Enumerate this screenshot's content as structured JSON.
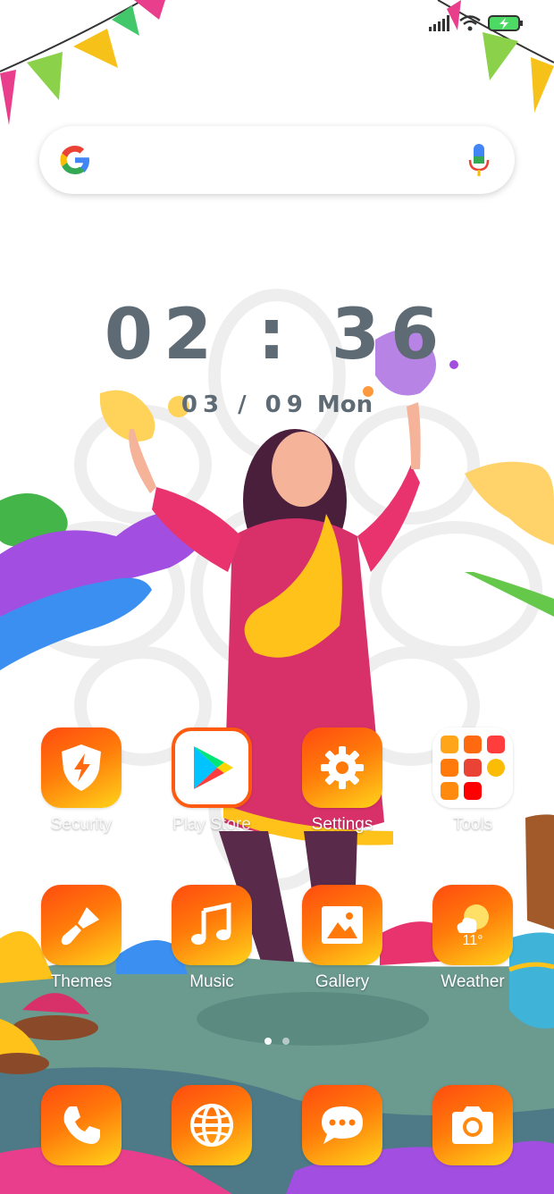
{
  "status_bar": {
    "icons": [
      "signal-icon",
      "wifi-icon",
      "battery-charging-icon"
    ]
  },
  "search": {
    "icons": [
      "google-icon",
      "mic-icon"
    ]
  },
  "clock": {
    "time": "02 : 36",
    "date": "03 / 09",
    "weekday": "Mon"
  },
  "apps": [
    {
      "label": "Security",
      "icon": "shield-bolt-icon"
    },
    {
      "label": "Play Store",
      "icon": "play-store-icon"
    },
    {
      "label": "Settings",
      "icon": "gear-icon"
    },
    {
      "label": "Tools",
      "icon": "folder-icon"
    },
    {
      "label": "Themes",
      "icon": "paintbrush-icon"
    },
    {
      "label": "Music",
      "icon": "music-note-icon"
    },
    {
      "label": "Gallery",
      "icon": "image-icon"
    },
    {
      "label": "Weather",
      "icon": "weather-icon",
      "temperature": "11°"
    }
  ],
  "dock": [
    {
      "icon": "phone-icon"
    },
    {
      "icon": "globe-icon"
    },
    {
      "icon": "chat-bubble-icon"
    },
    {
      "icon": "camera-icon"
    }
  ],
  "page_indicator": {
    "pages": 2,
    "current": 1
  },
  "colors": {
    "icon_gradient_start": "#ff4b10",
    "icon_gradient_end": "#ffd31a",
    "clock_text": "#5f6b74"
  }
}
